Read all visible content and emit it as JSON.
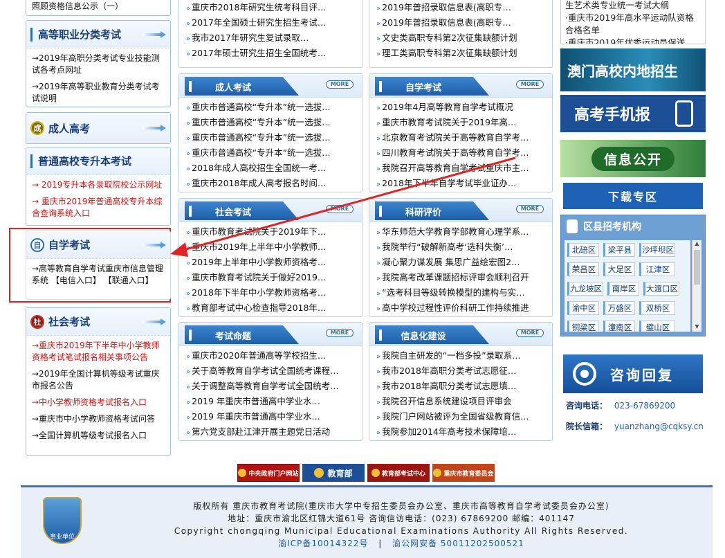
{
  "left": {
    "top_item": "照顾资格信息公示（一）",
    "sections": [
      {
        "title": "高等职业分类考试",
        "items": [
          "→2019年高职分类考试专业技能测试各考点网址",
          "→2019年高等职业教育分类考试考试说明"
        ]
      },
      {
        "title": "成人高考",
        "icon": "成",
        "items": []
      },
      {
        "title": "普通高校专升本考试",
        "items": [
          "→ 2019专升本各录取院校公示网址",
          "→ 重庆市2019年普通高校专升本综合查询系统入口"
        ]
      },
      {
        "title": "自学考试",
        "icon": "自",
        "items": [
          "→高等教育自学考试重庆市信息管理系统 【电信入口】 【联通入口】"
        ]
      },
      {
        "title": "社会考试",
        "icon": "社",
        "items": [
          "→重庆市2019年下半年中小学教师资格考试笔试报名相关事项公告",
          "→2019年全国计算机等级考试重庆市报名公告",
          "→中小学教师资格考试报名入口",
          "→重庆市中小学教师资格考试问答",
          "→全国计算机等级考试报名入口"
        ]
      }
    ]
  },
  "middle": {
    "top_col1": [
      "重庆市2018年研究生统考科目评…",
      "2017年全国硕士研究生招生考试…",
      "我市2017年研究生复试录取…",
      "2017年硕士研究生招生全国统考…"
    ],
    "top_col2": [
      "2019年普招录取信息表(高职专…",
      "2019年普招录取信息表(高职专…",
      "文史类高职专科第2次征集缺额计划",
      "理工类高职专科第2次征集缺额计划"
    ],
    "more_label": "MORE",
    "boxes": [
      {
        "title": "成人考试",
        "items": [
          "重庆市普通高校“专升本”统一选拔…",
          "重庆市普通高校“专升本”统一选拔…",
          "重庆市普通高校“专升本”统一选拔…",
          "重庆市普通高校“专升本”统一选拔…",
          "2018年成人高校招生全国统一考…",
          "重庆市2018年成人高考报名时间…"
        ]
      },
      {
        "title": "自学考试",
        "items": [
          "2019年4月高等教育自学考试概况",
          "重庆市教育考试院关于2019年高…",
          "北京教育考试院关于高等教育自学考…",
          "四川教育考试院关于高等教育自学考…",
          "我院召开高等教育自学考试重庆市主…",
          "2018年下半年自学考试毕业证办…"
        ]
      },
      {
        "title": "社会考试",
        "items": [
          "重庆市教育考试院关于2019年下…",
          "重庆市2019年上半年中小学教师…",
          "2019年上半年中小学教师资格考…",
          "重庆市教育考试院关于做好2019…",
          "2018年下半年中小学教师资格考…",
          "教育部考试中心检查指导2018年…"
        ]
      },
      {
        "title": "科研评价",
        "items": [
          "华东师范大学教育学部教育心理学系…",
          "我院举行“破解新高考‘选科失衡’…",
          "凝心聚力谋发展 集思广益绘宏图2…",
          "我院高考改革课题招标评审会顺利召开",
          "“选考科目等级转换模型的建构与实…",
          "高中学校过程性评价科研工作持续推进"
        ]
      },
      {
        "title": "考试命题",
        "items": [
          "重庆市2020年普通高等学校招生…",
          "关于高等教育自学考试全国统考课程…",
          "关于调整高等教育自学考试全国统考…",
          "2019 年重庆市普通高中学业水…",
          "2019 年重庆市普通高中学业水…",
          "第六党支部赴江津开展主题党日活动"
        ]
      },
      {
        "title": "信息化建设",
        "items": [
          "我院自主研发的“一档多投”录取系…",
          "我市2018年高职分类考试志愿征…",
          "我市2018年高职分类考试志愿填…",
          "我院召开信息系统建设项目评审会",
          "我院门户网站被评为全国省级教育信…",
          "我院参加2014年高考技术保障培…"
        ]
      }
    ]
  },
  "right": {
    "top_items": [
      "生艺术类专业统一考试大纲",
      "重庆市2019年高水平运动队资格合格名单",
      "重庆市2019年优秀运动员保送"
    ],
    "banner_macau": "澳门高校内地招生",
    "banner_mobile": "高考手机报",
    "banner_info": "信息公开",
    "banner_download": "下载专区",
    "district_title": "区县招考机构",
    "districts": [
      "北碚区",
      "梁平县",
      "沙坪坝区",
      "荣昌区",
      "大足区",
      "江津区",
      "九龙坡区",
      "南岸区",
      "大渡口区",
      "渝中区",
      "万盛区",
      "双桥区",
      "铜梁区",
      "潼南区",
      "璧山区"
    ],
    "consult": "咨询回复",
    "phone_label": "咨询电话：",
    "phone": "023-67869200",
    "mail_label": "院长信箱：",
    "mail": "yuanzhang@cqksy.cn"
  },
  "links": [
    "中央政府门户网站",
    "教育部",
    "教育部考试中心",
    "重庆市教育委员会"
  ],
  "footer": {
    "badge": "事业单位",
    "line1": "版权所有   重庆市教育考试院(重庆市大学中专招生委员会办公室、重庆市高等教育自学考试委员会办公室)",
    "line2": "地址：重庆市渝北区红锦大道61号 咨询信访电话：(023) 67869200 邮编：401147",
    "line3": "Copyright chongqing Municipal Educational Examinations Authority All Rights Reserved.",
    "icp": "渝ICP备10014322号",
    "sep": "|",
    "police": "渝公网安备 50011202500521"
  }
}
